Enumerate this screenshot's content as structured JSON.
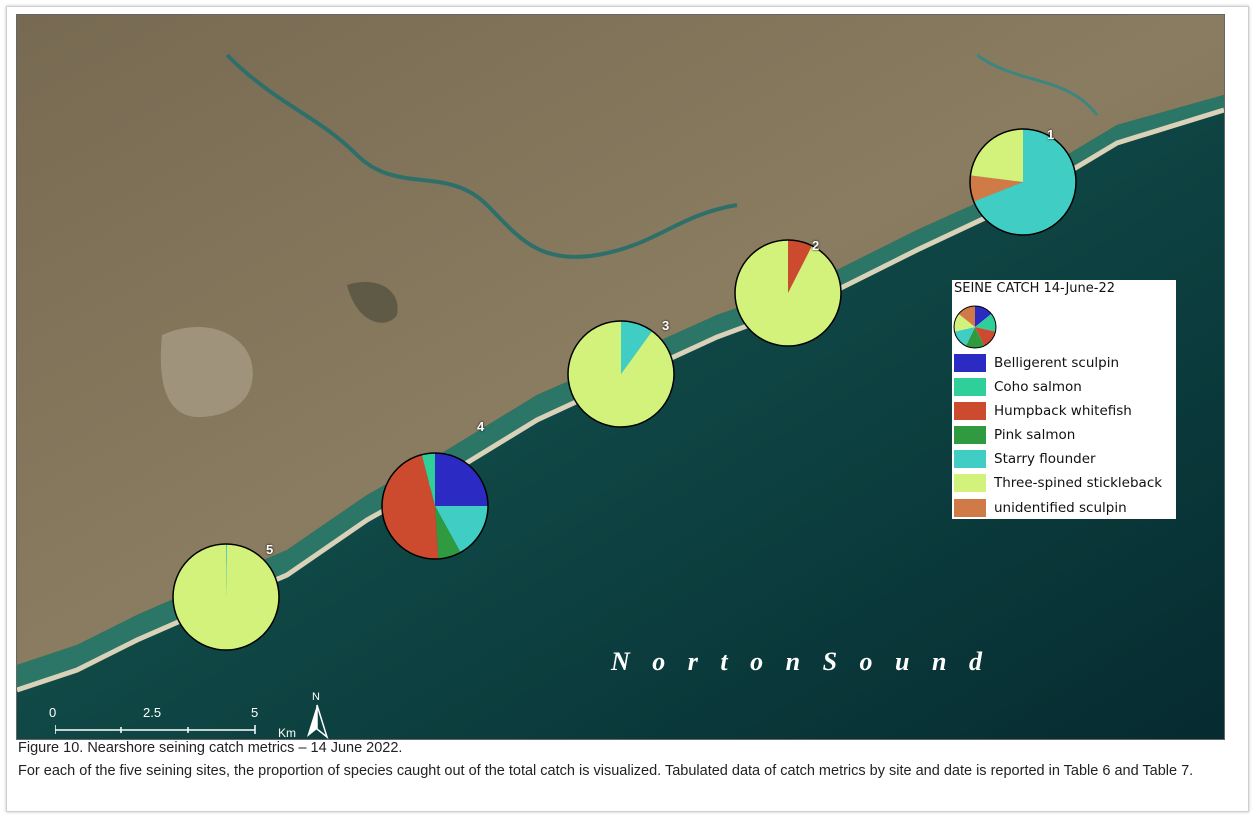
{
  "map": {
    "water_label": "N o r t o n   S o u n d",
    "sites": [
      {
        "label": "1",
        "slices": [
          {
            "species": "Starry flounder",
            "value": 0.69
          },
          {
            "species": "unidentified sculpin",
            "value": 0.08
          },
          {
            "species": "Three-spined stickleback",
            "value": 0.23
          }
        ]
      },
      {
        "label": "2",
        "slices": [
          {
            "species": "Humpback whitefish",
            "value": 0.075
          },
          {
            "species": "Three-spined stickleback",
            "value": 0.925
          }
        ]
      },
      {
        "label": "3",
        "slices": [
          {
            "species": "Starry flounder",
            "value": 0.1
          },
          {
            "species": "Three-spined stickleback",
            "value": 0.9
          }
        ]
      },
      {
        "label": "4",
        "slices": [
          {
            "species": "Belligerent sculpin",
            "value": 0.25
          },
          {
            "species": "Starry flounder",
            "value": 0.17
          },
          {
            "species": "Pink salmon",
            "value": 0.07
          },
          {
            "species": "Humpback whitefish",
            "value": 0.47
          },
          {
            "species": "Coho salmon",
            "value": 0.04
          }
        ]
      },
      {
        "label": "5",
        "slices": [
          {
            "species": "Starry flounder",
            "value": 0.003
          },
          {
            "species": "Three-spined stickleback",
            "value": 0.997
          }
        ]
      }
    ],
    "legend": {
      "title": "SEINE CATCH 14-June-22",
      "items": [
        {
          "label": "Belligerent sculpin",
          "color": "#2b2bc4"
        },
        {
          "label": "Coho salmon",
          "color": "#2fcf9a"
        },
        {
          "label": "Humpback whitefish",
          "color": "#cc4a2e"
        },
        {
          "label": "Pink salmon",
          "color": "#2f9a40"
        },
        {
          "label": "Starry flounder",
          "color": "#3fcdc4"
        },
        {
          "label": "Three-spined stickleback",
          "color": "#d2f27c"
        },
        {
          "label": "unidentified sculpin",
          "color": "#d07a47"
        }
      ]
    },
    "scale_bar": {
      "ticks": [
        "0",
        "2.5",
        "5"
      ],
      "unit": "Km"
    },
    "north_arrow": {
      "label": "N",
      "icon": "north-arrow-icon"
    }
  },
  "caption": {
    "title": "Figure 10. Nearshore seining catch metrics – 14 June 2022.",
    "body": "For each of the five seining sites, the proportion of species caught out of the total catch is visualized. Tabulated data of catch metrics by site and date is reported in Table 6 and Table 7."
  }
}
